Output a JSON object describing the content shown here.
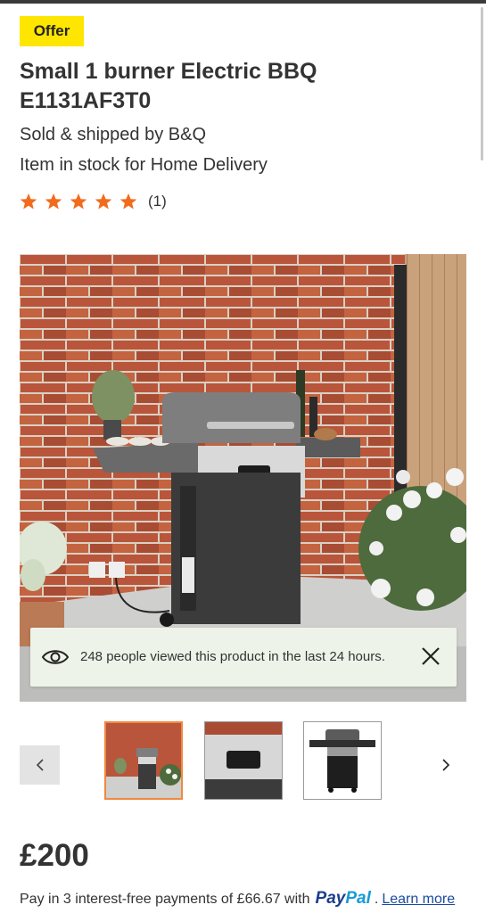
{
  "badge": {
    "offer_label": "Offer"
  },
  "product": {
    "title": "Small 1 burner Electric BBQ E1131AF3T0",
    "seller": "Sold & shipped by B&Q",
    "stock": "Item in stock for Home Delivery"
  },
  "rating": {
    "stars": 5,
    "max_stars": 5,
    "count_label": "(1)",
    "star_color": "#f26b1d"
  },
  "views_banner": {
    "text": "248 people viewed this product in the last 24 hours."
  },
  "gallery": {
    "thumbnails": [
      "bbq-patio-scene",
      "control-panel-closeup",
      "bbq-product-cutout"
    ],
    "active_index": 0
  },
  "price": {
    "amount": "£200"
  },
  "payment": {
    "text": "Pay in 3 interest-free payments of £66.67 with",
    "paypal_pay": "Pay",
    "paypal_pal": "Pal",
    "dot": ".",
    "learn_more": "Learn more"
  },
  "colors": {
    "offer_badge": "#ffe600",
    "active_thumb_border": "#f0883e",
    "link": "#1a4ba0"
  }
}
